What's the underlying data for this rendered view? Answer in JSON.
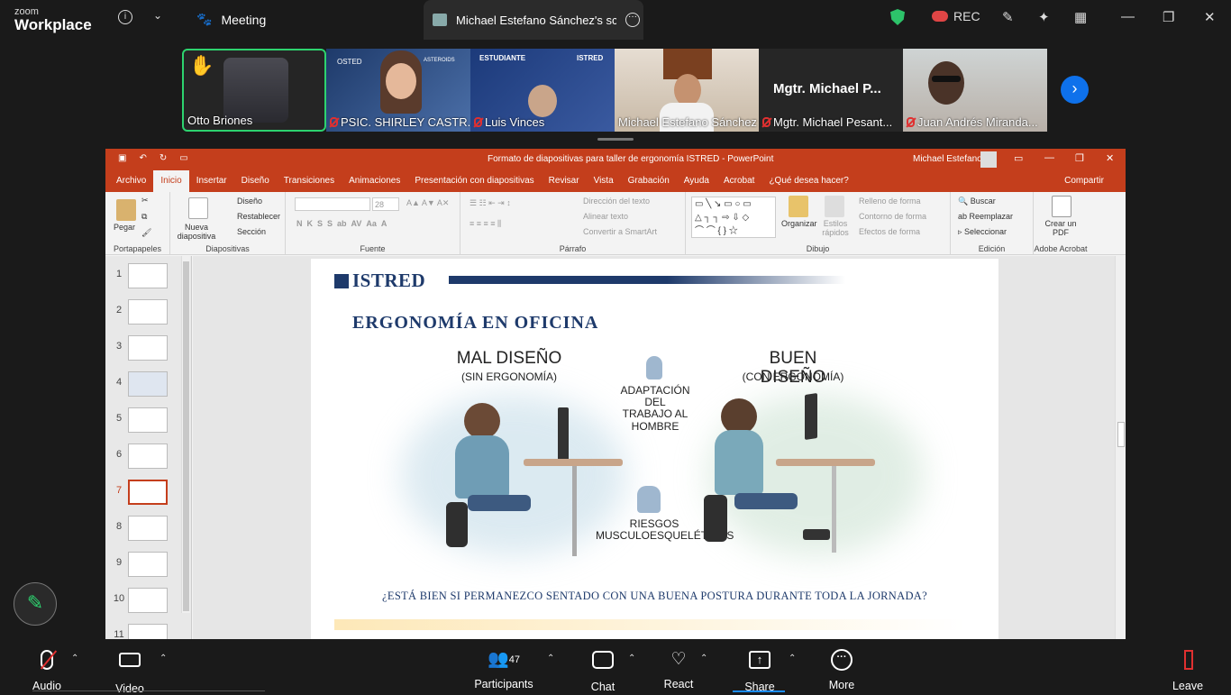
{
  "zoom": {
    "logo_small": "zoom",
    "logo_big": "Workplace",
    "info_icon": "info-icon",
    "meeting_label": "Meeting",
    "share_tab_title": "Michael Estefano Sánchez's screen",
    "rec_label": "REC",
    "colors": {
      "bg": "#1a1a1a",
      "accent": "#0e71eb",
      "active_speaker": "#2dd36f",
      "mute": "#e03030"
    }
  },
  "participants": [
    {
      "name": "Otto Briones",
      "muted": false,
      "raised_hand": true
    },
    {
      "name": "PSIC. SHIRLEY CASTR...",
      "muted": true,
      "badge_text_1": "OSTED",
      "badge_text_2": "ASTEROIDS"
    },
    {
      "name": "Luis Vinces",
      "muted": true,
      "badge_text_1": "ESTUDIANTE",
      "badge_text_2": "ISTRED"
    },
    {
      "name": "Michael Estefano Sánchez",
      "muted": false
    },
    {
      "name": "Mgtr. Michael Pesant...",
      "muted": true,
      "display_name": "Mgtr. Michael P..."
    },
    {
      "name": "Juan Andrés Miranda...",
      "muted": true
    }
  ],
  "powerpoint": {
    "window_title": "Formato de diapositivas para taller de ergonomía ISTRED  -  PowerPoint",
    "user": "Michael Estefano",
    "tabs": [
      "Archivo",
      "Inicio",
      "Insertar",
      "Diseño",
      "Transiciones",
      "Animaciones",
      "Presentación con diapositivas",
      "Revisar",
      "Vista",
      "Grabación",
      "Ayuda",
      "Acrobat",
      "¿Qué desea hacer?"
    ],
    "share": "Compartir",
    "ribbon": {
      "paste": "Pegar",
      "clipboard": "Portapapeles",
      "new_slide": "Nueva diapositiva",
      "layout": "Diseño",
      "reset": "Restablecer",
      "section": "Sección",
      "slides_group": "Diapositivas",
      "font_group": "Fuente",
      "font_size": "28",
      "paragraph_group": "Párrafo",
      "text_direction": "Dirección del texto",
      "align_text": "Alinear texto",
      "smartart": "Convertir a SmartArt",
      "arrange": "Organizar",
      "quick_styles": "Estilos rápidos",
      "shape_fill": "Relleno de forma",
      "shape_outline": "Contorno de forma",
      "shape_effects": "Efectos de forma",
      "drawing_group": "Dibujo",
      "find": "Buscar",
      "replace": "Reemplazar",
      "select": "Seleccionar",
      "editing_group": "Edición",
      "create_pdf": "Crear un PDF",
      "acrobat_group": "Adobe Acrobat"
    },
    "slide_numbers": [
      "1",
      "2",
      "3",
      "4",
      "5",
      "6",
      "7",
      "8",
      "9",
      "10",
      "11"
    ],
    "selected_slide": "7"
  },
  "slide": {
    "brand": "ISTRED",
    "title": "ERGONOMÍA EN OFICINA",
    "bad_title": "MAL DISEÑO",
    "bad_sub": "(SIN ERGONOMÍA)",
    "good_title": "BUEN DISEÑO",
    "good_sub": "(CON ERGONOMÍA)",
    "center_top": "ADAPTACIÓN DEL TRABAJO AL HOMBRE",
    "center_bottom": "RIESGOS MUSCULOESQUELÉTICOS",
    "question": "¿ESTÁ BIEN SI PERMANEZCO SENTADO CON UNA BUENA POSTURA DURANTE TODA LA JORNADA?"
  },
  "toolbar": {
    "audio": "Audio",
    "video": "Video",
    "participants": "Participants",
    "participants_count": "47",
    "chat": "Chat",
    "react": "React",
    "share": "Share",
    "more": "More",
    "leave": "Leave"
  }
}
